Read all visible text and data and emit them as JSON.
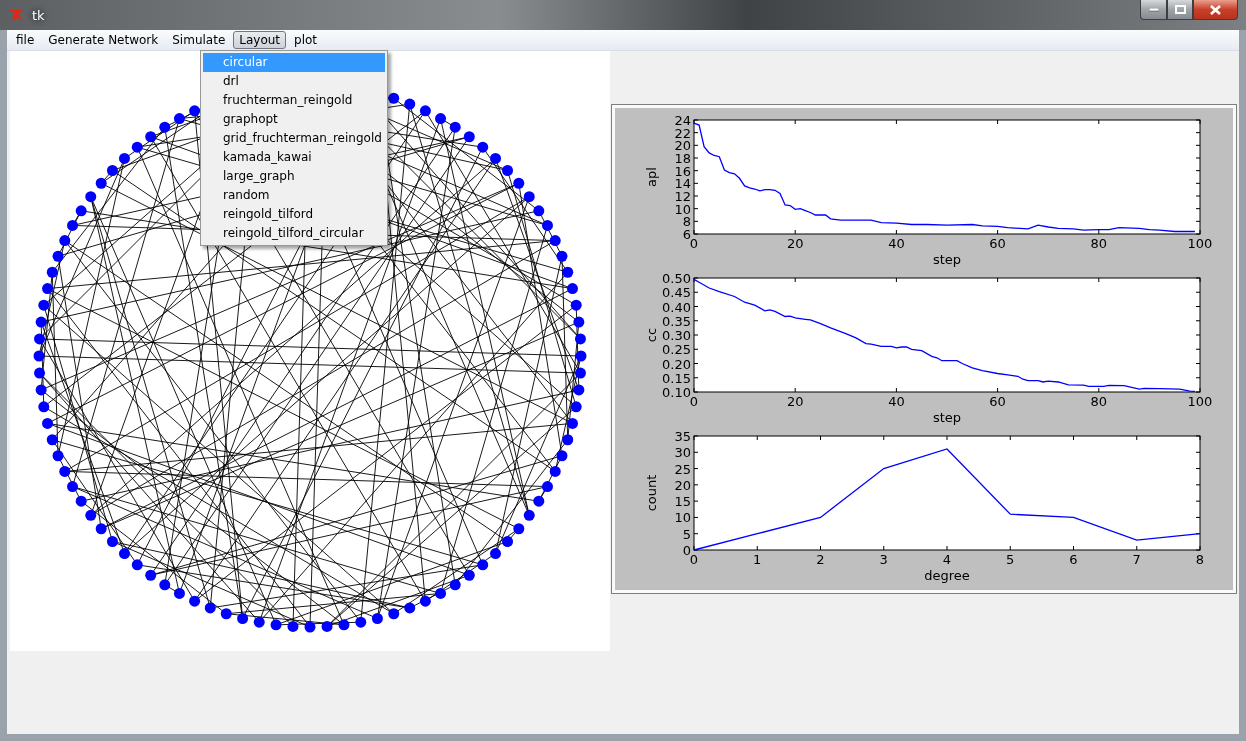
{
  "window": {
    "title": "tk"
  },
  "menu_bar": [
    {
      "label": "file",
      "selected": false
    },
    {
      "label": "Generate Network",
      "selected": false
    },
    {
      "label": "Simulate",
      "selected": false
    },
    {
      "label": "Layout",
      "selected": true
    },
    {
      "label": "plot",
      "selected": false
    }
  ],
  "layout_menu": {
    "items": [
      {
        "label": "circular",
        "selected": true
      },
      {
        "label": "drl",
        "selected": false
      },
      {
        "label": "fruchterman_reingold",
        "selected": false
      },
      {
        "label": "graphopt",
        "selected": false
      },
      {
        "label": "grid_fruchterman_reingold",
        "selected": false
      },
      {
        "label": "kamada_kawai",
        "selected": false
      },
      {
        "label": "large_graph",
        "selected": false
      },
      {
        "label": "random",
        "selected": false
      },
      {
        "label": "reingold_tilford",
        "selected": false
      },
      {
        "label": "reingold_tilford_circular",
        "selected": false
      }
    ]
  },
  "charts": [
    {
      "chart_data": {
        "type": "line",
        "xlabel": "step",
        "ylabel": "apl",
        "xlim": [
          0,
          100
        ],
        "ylim": [
          6,
          24
        ],
        "xticks": [
          0,
          20,
          40,
          60,
          80,
          100
        ],
        "yticks": [
          6,
          8,
          10,
          12,
          14,
          16,
          18,
          20,
          22,
          24
        ],
        "x": [
          0,
          1,
          2,
          3,
          4,
          5,
          6,
          7,
          8,
          9,
          10,
          11,
          12,
          13,
          14,
          15,
          16,
          17,
          18,
          19,
          20,
          21,
          22,
          23,
          24,
          26,
          27,
          29,
          32,
          35,
          37,
          40,
          43,
          46,
          50,
          55,
          57,
          60,
          62,
          66,
          68,
          70,
          72,
          75,
          77,
          80,
          82,
          84,
          88,
          90,
          92,
          95,
          98,
          99
        ],
        "series": [
          {
            "color": "#0000ff",
            "values": [
              23.5,
              23.2,
              19.8,
              18.8,
              18.4,
              18.2,
              16.1,
              15.7,
              15.5,
              14.8,
              13.6,
              13.3,
              13.1,
              12.8,
              13.0,
              13.0,
              12.9,
              12.4,
              10.6,
              10.5,
              9.9,
              10.0,
              9.7,
              9.4,
              9.0,
              9.0,
              8.4,
              8.2,
              8.2,
              8.2,
              7.8,
              7.7,
              7.5,
              7.5,
              7.4,
              7.5,
              7.3,
              7.2,
              7.0,
              6.8,
              7.4,
              7.1,
              6.9,
              6.8,
              6.6,
              6.7,
              6.7,
              7.0,
              6.9,
              6.7,
              6.6,
              6.4,
              6.4,
              6.4
            ]
          }
        ]
      }
    },
    {
      "chart_data": {
        "type": "line",
        "xlabel": "step",
        "ylabel": "cc",
        "xlim": [
          0,
          100
        ],
        "ylim": [
          0.1,
          0.5
        ],
        "xticks": [
          0,
          20,
          40,
          60,
          80,
          100
        ],
        "yticks": [
          {
            "value": 0.1,
            "label": "0.10"
          },
          {
            "value": 0.15,
            "label": "0.15"
          },
          {
            "value": 0.2,
            "label": "0.20"
          },
          {
            "value": 0.25,
            "label": "0.25"
          },
          {
            "value": 0.3,
            "label": "0.30"
          },
          {
            "value": 0.35,
            "label": "0.35"
          },
          {
            "value": 0.4,
            "label": "0.40"
          },
          {
            "value": 0.45,
            "label": "0.45"
          },
          {
            "value": 0.5,
            "label": "0.50"
          }
        ],
        "x": [
          0,
          1,
          3,
          5,
          8,
          10,
          12,
          14,
          15,
          16,
          18,
          19,
          20,
          22,
          23,
          25,
          27,
          30,
          32,
          34,
          35,
          37,
          39,
          40,
          41,
          42,
          43,
          45,
          47,
          48,
          49,
          50,
          52,
          53,
          55,
          57,
          60,
          62,
          64,
          65,
          66,
          68,
          69,
          70,
          72,
          74,
          77,
          78,
          81,
          82,
          85,
          88,
          89,
          92,
          96,
          98,
          99
        ],
        "series": [
          {
            "color": "#0000ff",
            "values": [
              0.495,
              0.485,
              0.465,
              0.452,
              0.435,
              0.415,
              0.405,
              0.385,
              0.388,
              0.383,
              0.365,
              0.366,
              0.36,
              0.355,
              0.353,
              0.34,
              0.325,
              0.305,
              0.29,
              0.27,
              0.268,
              0.26,
              0.26,
              0.255,
              0.258,
              0.258,
              0.25,
              0.245,
              0.225,
              0.22,
              0.21,
              0.21,
              0.21,
              0.2,
              0.185,
              0.175,
              0.165,
              0.16,
              0.155,
              0.145,
              0.14,
              0.14,
              0.135,
              0.138,
              0.135,
              0.125,
              0.124,
              0.12,
              0.12,
              0.123,
              0.122,
              0.11,
              0.113,
              0.112,
              0.11,
              0.103,
              0.102
            ]
          }
        ]
      }
    },
    {
      "chart_data": {
        "type": "line",
        "xlabel": "degree",
        "ylabel": "count",
        "xlim": [
          0,
          8
        ],
        "ylim": [
          0,
          35
        ],
        "xticks": [
          0,
          1,
          2,
          3,
          4,
          5,
          6,
          7,
          8
        ],
        "yticks": [
          0,
          5,
          10,
          15,
          20,
          25,
          30,
          35
        ],
        "x": [
          0,
          1,
          2,
          3,
          4,
          5,
          6,
          7,
          8
        ],
        "series": [
          {
            "color": "#0000ff",
            "values": [
              0,
              5,
              10,
              25,
              31,
              11,
              10,
              3,
              5
            ]
          }
        ]
      }
    }
  ]
}
